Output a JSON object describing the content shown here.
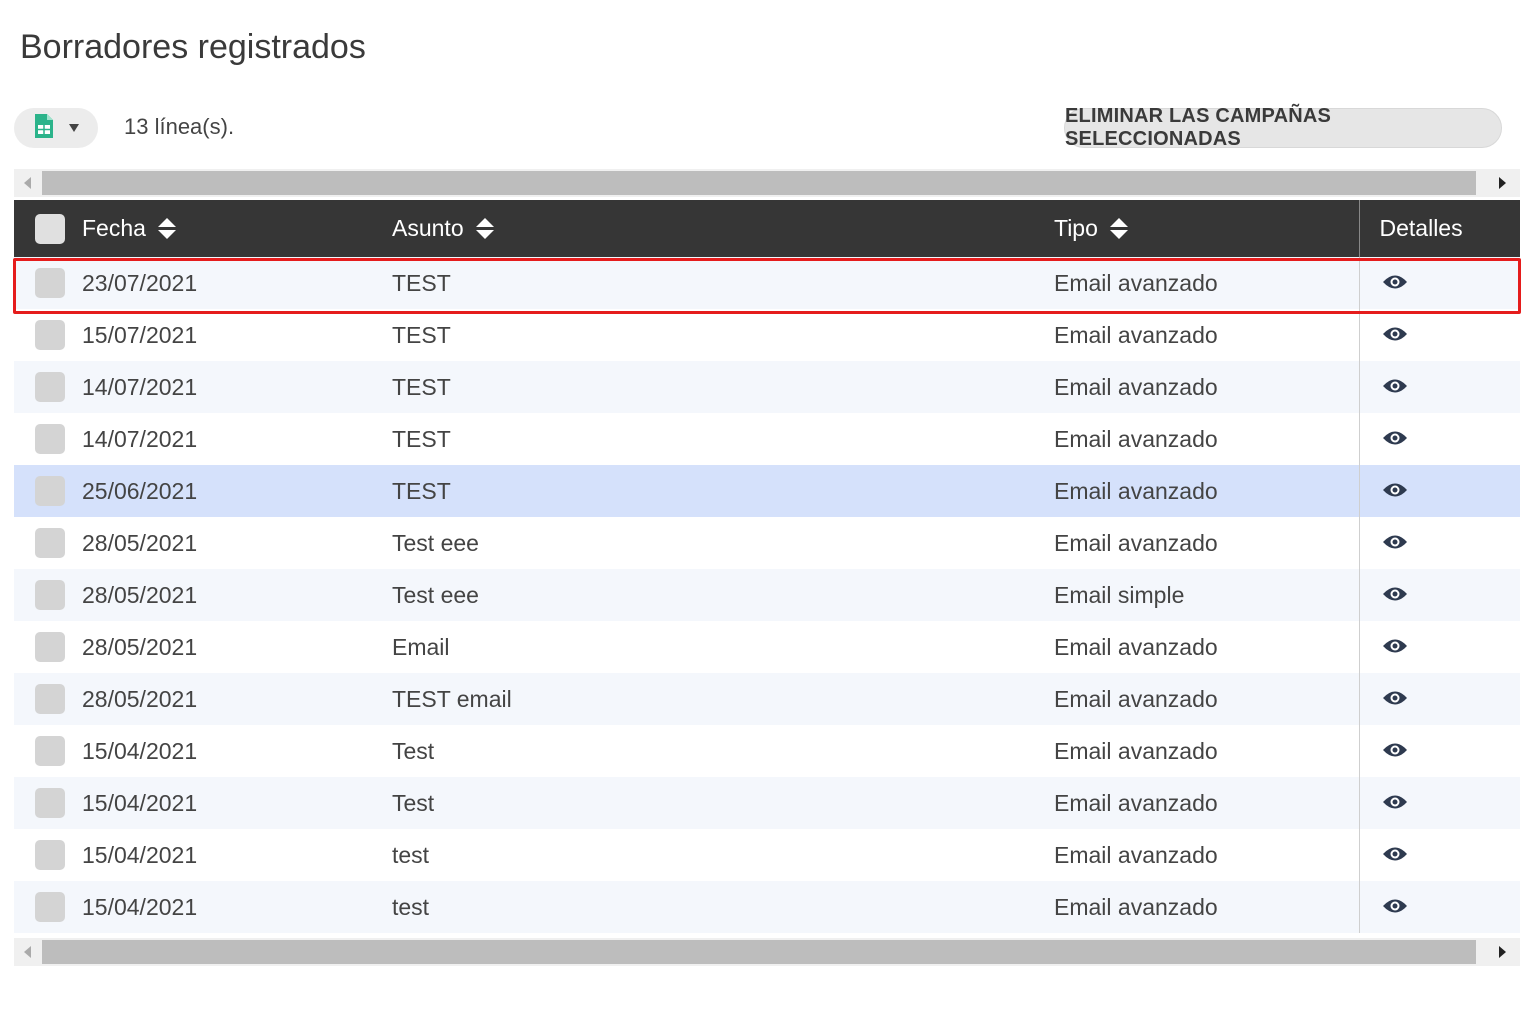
{
  "page": {
    "title": "Borradores registrados"
  },
  "toolbar": {
    "row_count": "13 línea(s).",
    "delete_label": "ELIMINAR LAS CAMPAÑAS SELECCIONADAS",
    "export_icon": "spreadsheet-icon"
  },
  "table": {
    "headers": {
      "fecha": "Fecha",
      "asunto": "Asunto",
      "tipo": "Tipo",
      "detalles": "Detalles"
    },
    "rows": [
      {
        "fecha": "23/07/2021",
        "asunto": "TEST",
        "tipo": "Email avanzado"
      },
      {
        "fecha": "15/07/2021",
        "asunto": "TEST",
        "tipo": "Email avanzado"
      },
      {
        "fecha": "14/07/2021",
        "asunto": "TEST",
        "tipo": "Email avanzado"
      },
      {
        "fecha": "14/07/2021",
        "asunto": "TEST",
        "tipo": "Email avanzado"
      },
      {
        "fecha": "25/06/2021",
        "asunto": "TEST",
        "tipo": "Email avanzado"
      },
      {
        "fecha": "28/05/2021",
        "asunto": "Test eee",
        "tipo": "Email avanzado"
      },
      {
        "fecha": "28/05/2021",
        "asunto": "Test eee",
        "tipo": "Email simple"
      },
      {
        "fecha": "28/05/2021",
        "asunto": "Email",
        "tipo": "Email avanzado"
      },
      {
        "fecha": "28/05/2021",
        "asunto": "TEST email",
        "tipo": "Email avanzado"
      },
      {
        "fecha": "15/04/2021",
        "asunto": "Test",
        "tipo": "Email avanzado"
      },
      {
        "fecha": "15/04/2021",
        "asunto": "Test",
        "tipo": "Email avanzado"
      },
      {
        "fecha": "15/04/2021",
        "asunto": "test",
        "tipo": "Email avanzado"
      },
      {
        "fecha": "15/04/2021",
        "asunto": "test",
        "tipo": "Email avanzado"
      }
    ]
  },
  "colors": {
    "header_bg": "#363636",
    "hover_row": "#d5e1fb",
    "highlight": "#e51c1c",
    "export_icon": "#2bb38a"
  }
}
